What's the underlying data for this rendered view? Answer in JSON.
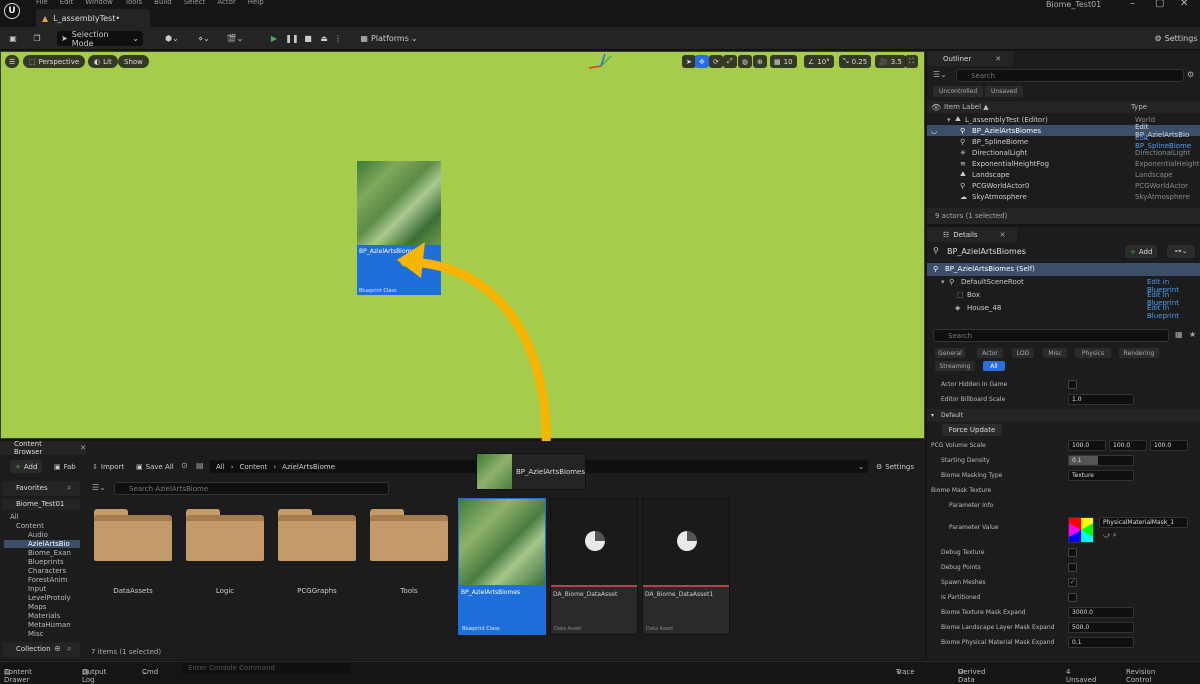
{
  "menu": [
    "File",
    "Edit",
    "Window",
    "Tools",
    "Build",
    "Select",
    "Actor",
    "Help"
  ],
  "document_tab": "L_assemblyTest•",
  "project_title": "Biome_Test01",
  "toolbar": {
    "selection_mode": "Selection Mode",
    "platforms": "Platforms",
    "settings": "Settings"
  },
  "viewport": {
    "perspective": "Perspective",
    "lit": "Lit",
    "show": "Show",
    "grid_value": "10",
    "angle_value": "10°",
    "scale_value": "0.25",
    "cam_speed": "3.5",
    "drag_thumb_name": "BP_AzielArtsBiomes",
    "drag_thumb_sub": "Blueprint Class"
  },
  "outliner": {
    "tab": "Outliner",
    "search_placeholder": "Search",
    "chips": [
      "Uncontrolled",
      "Unsaved"
    ],
    "col_label": "Item Label ▲",
    "col_type": "Type",
    "rows": [
      {
        "name": "L_assemblyTest (Editor)",
        "type": "World"
      },
      {
        "name": "BP_AzielArtsBiomes",
        "type": "Edit BP_AzielArtsBio"
      },
      {
        "name": "BP_SplineBiome",
        "type": "Edit BP_SplineBiome"
      },
      {
        "name": "DirectionalLight",
        "type": "DirectionalLight"
      },
      {
        "name": "ExponentialHeightFog",
        "type": "ExponentialHeightF"
      },
      {
        "name": "Landscape",
        "type": "Landscape"
      },
      {
        "name": "PCGWorldActor0",
        "type": "PCGWorldActor"
      },
      {
        "name": "SkyAtmosphere",
        "type": "SkyAtmosphere"
      }
    ],
    "footer": "9 actors (1 selected)"
  },
  "details": {
    "tab": "Details",
    "title": "BP_AzielArtsBiomes",
    "add": "Add",
    "components": [
      {
        "name": "BP_AzielArtsBiomes (Self)",
        "link": ""
      },
      {
        "name": "DefaultSceneRoot",
        "link": "Edit in Blueprint"
      },
      {
        "name": "Box",
        "link": "Edit in Blueprint"
      },
      {
        "name": "House_48",
        "link": "Edit in Blueprint"
      }
    ],
    "search_placeholder": "Search",
    "filter_tabs": [
      "General",
      "Actor",
      "LOD",
      "Misc",
      "Physics",
      "Rendering",
      "Streaming",
      "All"
    ],
    "props": {
      "actor_hidden": "Actor Hidden In Game",
      "billboard": "Editor Billboard Scale",
      "billboard_val": "1.0",
      "default_section": "Default",
      "force_update": "Force Update",
      "pcg_volume": "PCG Volume Scale",
      "pcg_x": "100.0",
      "pcg_y": "100.0",
      "pcg_z": "100.0",
      "starting_density": "Starting Density",
      "starting_density_val": "0.1",
      "masking_type": "Biome Masking Type",
      "masking_type_val": "Texture",
      "mask_texture": "Biome Mask Texture",
      "param_info": "Parameter Info",
      "param_value": "Parameter Value",
      "param_value_val": "PhysicalMaterialMask_1",
      "debug_texture": "Debug Texture",
      "debug_points": "Debug Points",
      "spawn_meshes": "Spawn Meshes",
      "is_partitioned": "Is Partitioned",
      "tex_expand": "Biome Texture Mask Expand",
      "tex_expand_val": "3000.0",
      "layer_expand": "Biome Landscape Layer Mask Expand",
      "layer_expand_val": "500.0",
      "phys_expand": "Biome Physical Material Mask Expand",
      "phys_expand_val": "0.1"
    }
  },
  "content_browser": {
    "tab": "Content Browser",
    "add": "Add",
    "fab": "Fab",
    "import": "Import",
    "save_all": "Save All",
    "breadcrumb": [
      "All",
      "Content",
      "AzielArtsBiome"
    ],
    "settings": "Settings",
    "drag_label": "BP_AzielArtsBiomes",
    "favorites": "Favorites",
    "project": "Biome_Test01",
    "tree": [
      "All",
      "Content",
      "Audio",
      "AzielArtsBio",
      "Biome_Exan",
      "Blueprints",
      "Characters",
      "ForestAnim",
      "Input",
      "LevelProtoly",
      "Maps",
      "Materials",
      "MetaHuman",
      "Misc"
    ],
    "collections": "Collection",
    "search_placeholder": "Search AzielArtsBiome",
    "folders": [
      "DataAssets",
      "Logic",
      "PCGGraphs",
      "Tools"
    ],
    "assets": [
      {
        "name": "BP_AzielArtsBiomes",
        "sub": "Blueprint Class"
      },
      {
        "name": "DA_Biome_DataAsset",
        "sub": "Data Asset"
      },
      {
        "name": "DA_Biome_DataAsset1",
        "sub": "Data Asset"
      }
    ],
    "footer": "7 items (1 selected)"
  },
  "status": {
    "drawer": "Content Drawer",
    "output": "Output Log",
    "cmd": "Cmd",
    "console": "Enter Console Command",
    "trace": "Trace",
    "derived": "Derived Data",
    "unsaved": "4 Unsaved",
    "revision": "Revision Control"
  }
}
